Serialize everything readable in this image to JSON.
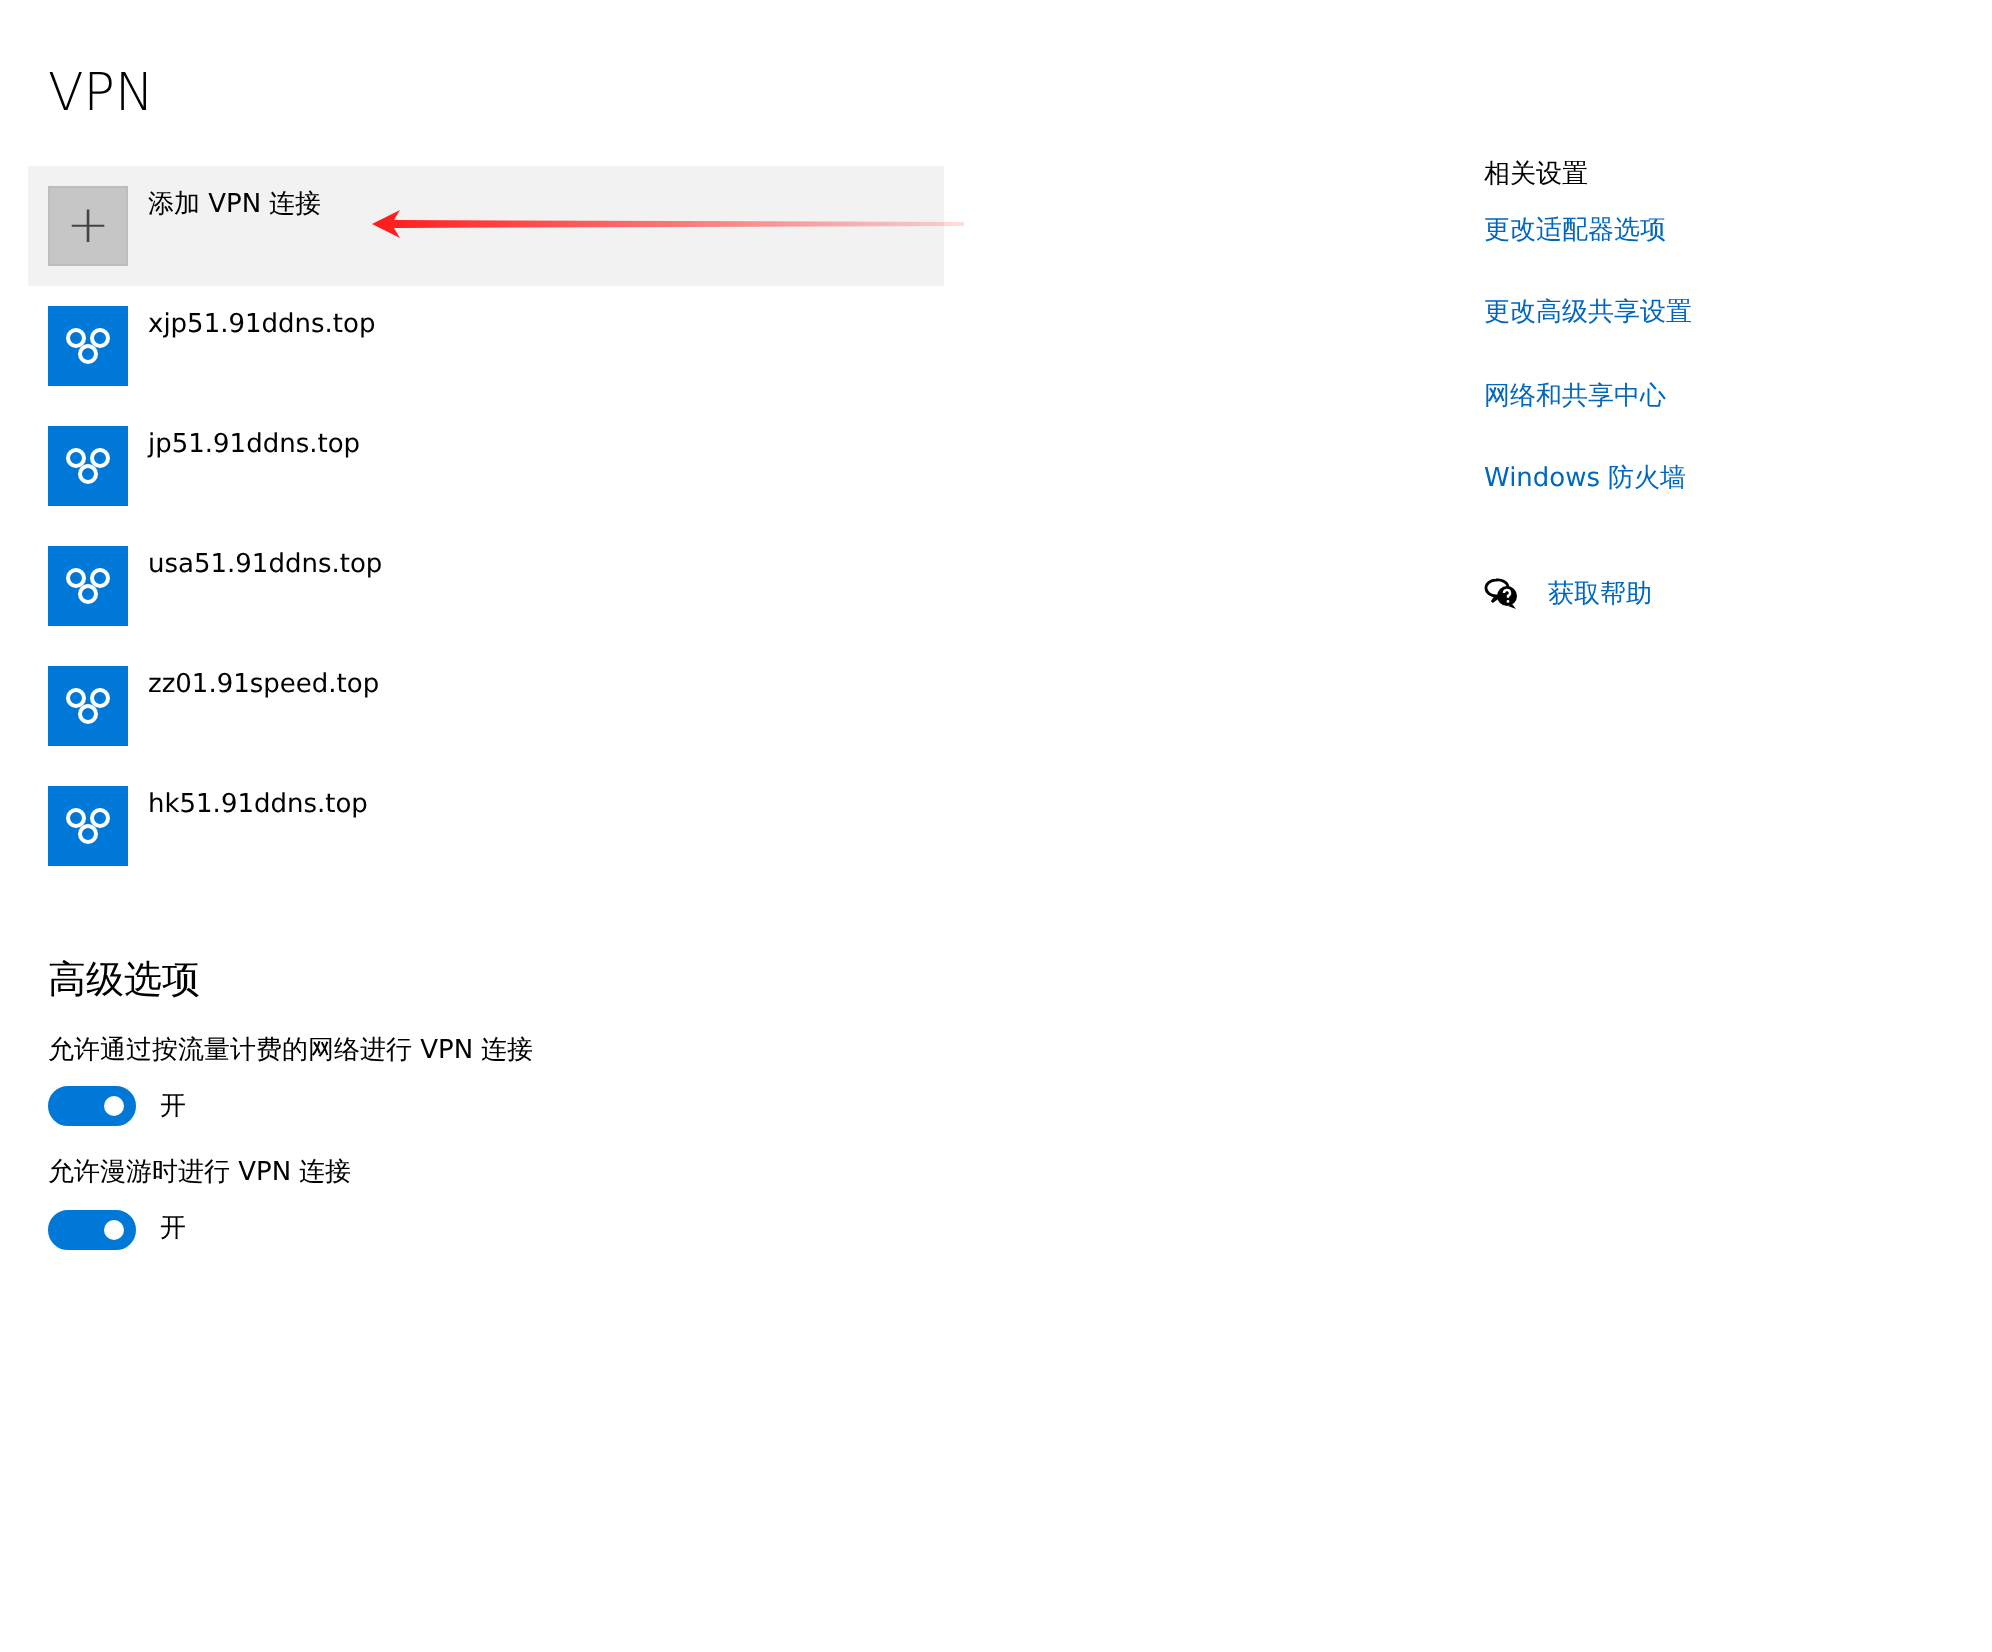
{
  "title": "VPN",
  "add_connection": {
    "label": "添加 VPN 连接",
    "symbol": "+"
  },
  "connections": [
    {
      "name": "xjp51.91ddns.top"
    },
    {
      "name": "jp51.91ddns.top"
    },
    {
      "name": "usa51.91ddns.top"
    },
    {
      "name": "zz01.91speed.top"
    },
    {
      "name": "hk51.91ddns.top"
    }
  ],
  "advanced": {
    "heading": "高级选项",
    "options": [
      {
        "label": "允许通过按流量计费的网络进行 VPN 连接",
        "on": true,
        "state_text": "开"
      },
      {
        "label": "允许漫游时进行 VPN 连接",
        "on": true,
        "state_text": "开"
      }
    ]
  },
  "related": {
    "heading": "相关设置",
    "links": [
      "更改适配器选项",
      "更改高级共享设置",
      "网络和共享中心",
      "Windows 防火墙"
    ]
  },
  "help": {
    "label": "获取帮助"
  }
}
